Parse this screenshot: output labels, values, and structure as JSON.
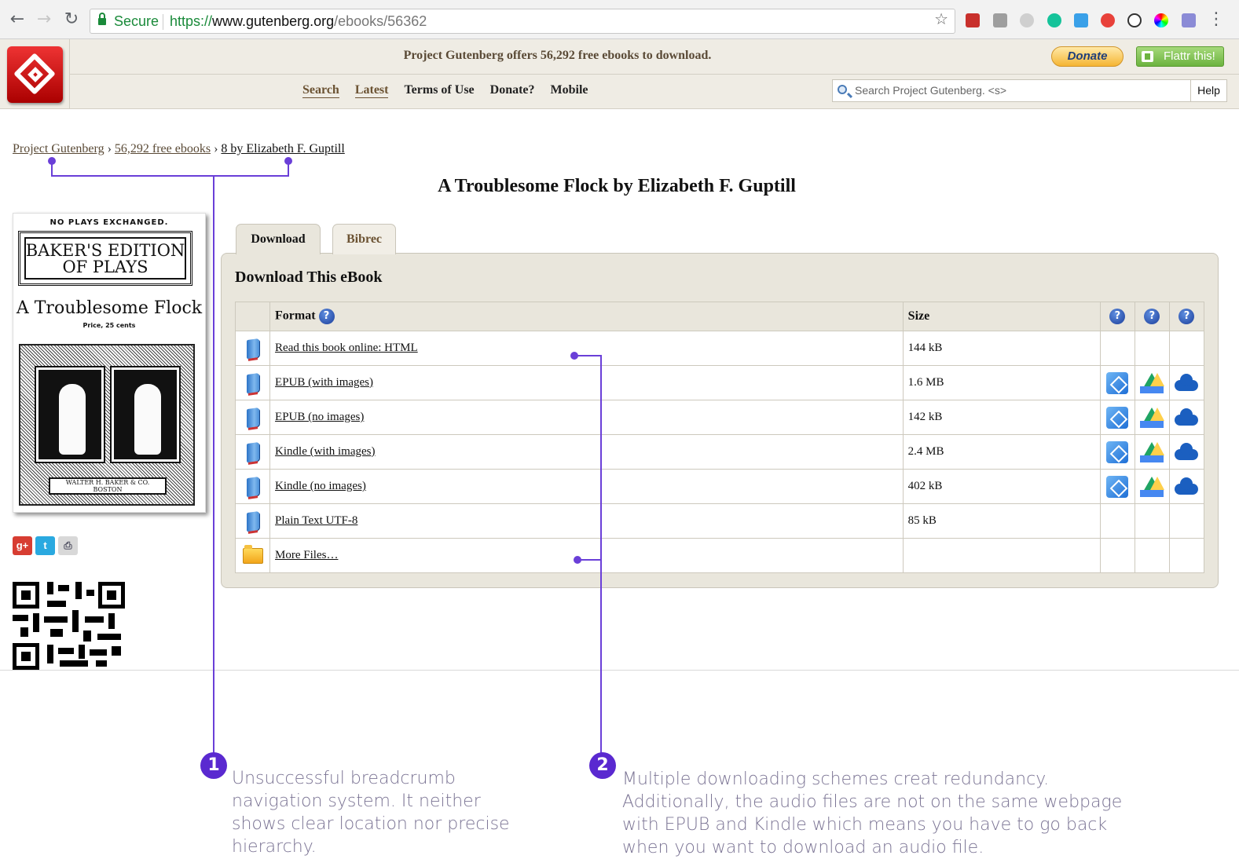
{
  "browser": {
    "secure_label": "Secure",
    "url_scheme": "https://",
    "url_host": "www.gutenberg.org",
    "url_path": "/ebooks/56362"
  },
  "header": {
    "offer_text": "Project Gutenberg offers 56,292 free ebooks to download.",
    "donate_label": "Donate",
    "flattr_label": "Flattr this!",
    "nav": [
      "Search",
      "Latest",
      "Terms of Use",
      "Donate?",
      "Mobile"
    ],
    "search_placeholder": "Search Project Gutenberg. <s>",
    "help_label": "Help"
  },
  "breadcrumb": {
    "items": [
      "Project Gutenberg",
      "56,292 free ebooks",
      "8 by Elizabeth F. Guptill"
    ],
    "separator": "›"
  },
  "book": {
    "title": "A Troublesome Flock by Elizabeth F. Guptill"
  },
  "cover": {
    "no_plays": "NO PLAYS EXCHANGED.",
    "edition_line1": "BAKER'S EDITION",
    "edition_line2": "OF PLAYS",
    "title": "A Troublesome Flock",
    "price": "Price, 25 cents",
    "publisher": "WALTER H. BAKER & CO.",
    "city": "BOSTON"
  },
  "social": [
    "g+",
    "twitter",
    "print"
  ],
  "tabs": [
    "Download",
    "Bibrec"
  ],
  "download": {
    "heading": "Download This eBook",
    "columns": {
      "format": "Format",
      "size": "Size"
    },
    "rows": [
      {
        "icon": "book-icon",
        "label": "Read this book online: HTML",
        "size": "144 kB",
        "cloud": false
      },
      {
        "icon": "book-icon",
        "label": "EPUB (with images)",
        "size": "1.6 MB",
        "cloud": true
      },
      {
        "icon": "book-icon",
        "label": "EPUB (no images)",
        "size": "142 kB",
        "cloud": true
      },
      {
        "icon": "book-icon",
        "label": "Kindle (with images)",
        "size": "2.4 MB",
        "cloud": true
      },
      {
        "icon": "book-icon",
        "label": "Kindle (no images)",
        "size": "402 kB",
        "cloud": true
      },
      {
        "icon": "book-icon",
        "label": "Plain Text UTF-8",
        "size": "85 kB",
        "cloud": false
      },
      {
        "icon": "folder-icon",
        "label": "More Files…",
        "size": "",
        "cloud": false
      }
    ]
  },
  "annotations": [
    {
      "number": "1",
      "text": "Unsuccessful breadcrumb navigation system. It neither shows clear location nor precise hierarchy."
    },
    {
      "number": "2",
      "text": "Multiple downloading schemes creat redundancy. Additionally, the audio files are not on the same webpage with EPUB and Kindle which means you have to go back when you want to download an audio file."
    }
  ],
  "colors": {
    "accent": "#6a3fd8",
    "header_bg": "#efece4",
    "link_brown": "#5a4a36"
  }
}
